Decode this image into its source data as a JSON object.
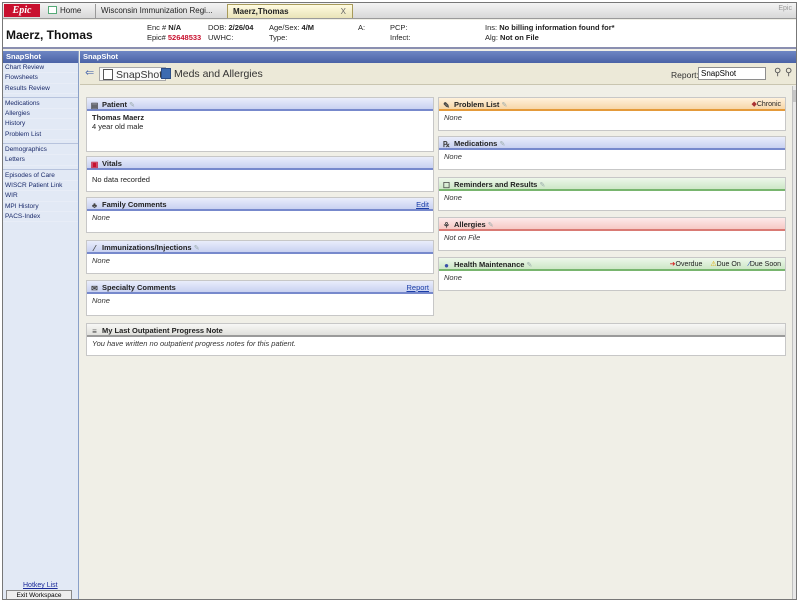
{
  "tabs": {
    "logo": "Epic",
    "home": "Home",
    "wir": "Wisconsin Immunization Regi...",
    "patient": "Maerz,Thomas",
    "patient_close": "X",
    "right": "Epic"
  },
  "patient_header": {
    "name": "Maerz, Thomas",
    "enc_label": "Enc #",
    "enc_value": "N/A",
    "epic_label": "Epic#",
    "epic_value": "52648533",
    "dob_label": "DOB:",
    "dob_value": "2/26/04",
    "uwhc_label": "UWHC:",
    "agesex_label": "Age/Sex:",
    "agesex_value": "4/M",
    "type_label": "Type:",
    "a_label": "A:",
    "pcp_label": "PCP:",
    "infect_label": "Infect:",
    "ins_label": "Ins:",
    "ins_value": "No billing information found for*",
    "alg_label": "Alg:",
    "alg_value": "Not on File"
  },
  "sidebar": {
    "active": "SnapShot",
    "items": [
      "Chart Review",
      "Flowsheets",
      "Results Review",
      "Medications",
      "Allergies",
      "History",
      "Problem List",
      "Demographics",
      "Letters",
      "Episodes of Care",
      "WISCR Patient Link",
      "WIR",
      "MPI History",
      "PACS-Index"
    ],
    "hotkey": "Hotkey List",
    "exit": "Exit Workspace"
  },
  "toolbar": {
    "section_title": "SnapShot",
    "tab_snapshot": "SnapShot",
    "tab_meds": "Meds and Allergies",
    "report_label": "Report:",
    "report_value": "SnapShot"
  },
  "sections": {
    "patient": {
      "title": "Patient",
      "name": "Thomas Maerz",
      "desc": "4 year old male"
    },
    "vitals": {
      "title": "Vitals",
      "body": "No data recorded"
    },
    "family": {
      "title": "Family Comments",
      "link": "Edit",
      "body": "None"
    },
    "immunizations": {
      "title": "Immunizations/Injections",
      "body": "None"
    },
    "specialty": {
      "title": "Specialty Comments",
      "link": "Report",
      "body": "None"
    },
    "problem_list": {
      "title": "Problem List",
      "chronic": "Chronic",
      "body": "None"
    },
    "medications": {
      "title": "Medications",
      "body": "None"
    },
    "reminders": {
      "title": "Reminders and Results",
      "body": "None"
    },
    "allergies": {
      "title": "Allergies",
      "body": "Not on File"
    },
    "health": {
      "title": "Health Maintenance",
      "overdue": "Overdue",
      "due_on": "Due On",
      "due_soon": "Due Soon",
      "body": "None"
    },
    "progress": {
      "title": "My Last Outpatient Progress Note",
      "body": "You have written no outpatient progress notes for this patient."
    }
  },
  "colors": {
    "epic_red": "#c8102e",
    "nav_blue": "#4a62a6",
    "problem_orange": "#e49a3a",
    "green_header": "#78b56e",
    "allergy_red": "#d97a74"
  }
}
